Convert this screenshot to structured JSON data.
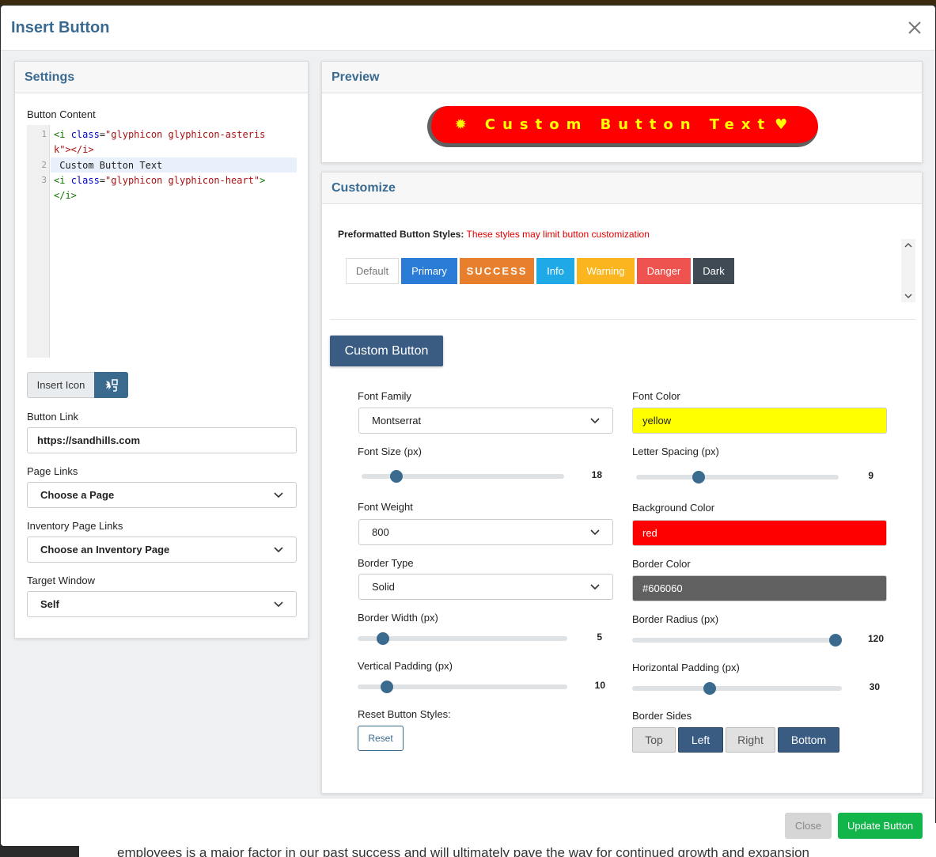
{
  "modal": {
    "title": "Insert Button"
  },
  "background_text": "employees is a major factor in our past success and will ultimately pave the way for continued growth and expansion",
  "settings": {
    "title": "Settings",
    "button_content_label": "Button Content",
    "code_lines": [
      {
        "num": "1",
        "parts": [
          "<i ",
          "class",
          "=",
          "\"glyphicon glyphicon-asteris"
        ],
        "wrap": "k\"></i>"
      },
      {
        "num": "2",
        "text": " Custom Button Text"
      },
      {
        "num": "3",
        "parts": [
          "<i ",
          "class",
          "=",
          "\"glyphicon glyphicon-heart\""
        ],
        "tail": ">",
        "wrap": "</i>"
      }
    ],
    "insert_icon_label": "Insert Icon",
    "button_link_label": "Button Link",
    "button_link_value": "https://sandhills.com",
    "page_links_label": "Page Links",
    "page_links_value": "Choose a Page",
    "inventory_links_label": "Inventory Page Links",
    "inventory_links_value": "Choose an Inventory Page",
    "target_window_label": "Target Window",
    "target_window_value": "Self"
  },
  "preview": {
    "title": "Preview",
    "button_text": "Custom Button Text",
    "text_color": "#ffff00",
    "bg_color": "#ff0000",
    "border_color": "#606060"
  },
  "customize": {
    "title": "Customize",
    "preformatted_label": "Preformatted Button Styles:",
    "preformatted_warning": "These styles may limit button customization",
    "styles": [
      {
        "label": "Default",
        "bg": "#ffffff",
        "fg": "#777777"
      },
      {
        "label": "Primary",
        "bg": "#2b7cd6",
        "fg": "#ffffff"
      },
      {
        "label": "SUCCESS",
        "bg": "#e87f2c",
        "fg": "#ffffff"
      },
      {
        "label": "Info",
        "bg": "#1fa9e6",
        "fg": "#ffffff"
      },
      {
        "label": "Warning",
        "bg": "#fbb61f",
        "fg": "#ffffff"
      },
      {
        "label": "Danger",
        "bg": "#ef5350",
        "fg": "#ffffff"
      },
      {
        "label": "Dark",
        "bg": "#3f4a55",
        "fg": "#ffffff"
      }
    ],
    "custom_button_label": "Custom Button",
    "font_family_label": "Font Family",
    "font_family_value": "Montserrat",
    "font_color_label": "Font Color",
    "font_color_value": "yellow",
    "font_size_label": "Font Size (px)",
    "font_size_value": "18",
    "font_size_fraction": 0.17,
    "letter_spacing_label": "Letter Spacing (px)",
    "letter_spacing_value": "9",
    "letter_spacing_fraction": 0.31,
    "font_weight_label": "Font Weight",
    "font_weight_value": "800",
    "background_color_label": "Background Color",
    "background_color_value": "red",
    "border_type_label": "Border Type",
    "border_type_value": "Solid",
    "border_color_label": "Border Color",
    "border_color_value": "#606060",
    "border_width_label": "Border Width (px)",
    "border_width_value": "5",
    "border_width_fraction": 0.12,
    "border_radius_label": "Border Radius (px)",
    "border_radius_value": "120",
    "border_radius_fraction": 0.97,
    "vertical_padding_label": "Vertical Padding (px)",
    "vertical_padding_value": "10",
    "vertical_padding_fraction": 0.14,
    "horizontal_padding_label": "Horizontal Padding (px)",
    "horizontal_padding_value": "30",
    "horizontal_padding_fraction": 0.37,
    "reset_label": "Reset Button Styles:",
    "reset_button": "Reset",
    "border_sides_label": "Border Sides",
    "border_sides": [
      {
        "label": "Top",
        "active": false
      },
      {
        "label": "Left",
        "active": true
      },
      {
        "label": "Right",
        "active": false
      },
      {
        "label": "Bottom",
        "active": true
      }
    ]
  },
  "footer": {
    "close_label": "Close",
    "update_label": "Update Button"
  }
}
